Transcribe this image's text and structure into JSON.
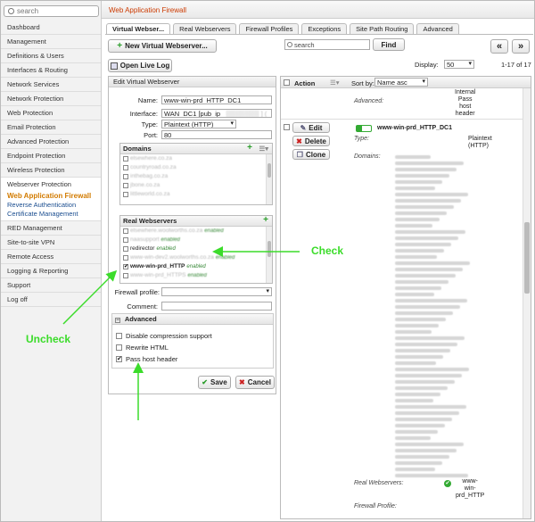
{
  "sidebar": {
    "search_placeholder": "search",
    "items": [
      "Dashboard",
      "Management",
      "Definitions & Users",
      "Interfaces & Routing",
      "Network Services",
      "Network Protection",
      "Web Protection",
      "Email Protection",
      "Advanced Protection",
      "Endpoint Protection",
      "Wireless Protection"
    ],
    "open_group": {
      "label": "Webserver Protection",
      "subs": [
        "Web Application Firewall",
        "Reverse Authentication",
        "Certificate Management"
      ]
    },
    "items_after": [
      "RED Management",
      "Site-to-site VPN",
      "Remote Access",
      "Logging & Reporting",
      "Support",
      "Log off"
    ]
  },
  "header": {
    "title": "Web Application Firewall"
  },
  "tabs": [
    "Virtual Webser...",
    "Real Webservers",
    "Firewall Profiles",
    "Exceptions",
    "Site Path Routing",
    "Advanced"
  ],
  "toolbar": {
    "new_vws": "New Virtual Webserver...",
    "open_live_log": "Open Live Log",
    "search_placeholder": "search",
    "find": "Find",
    "prev": "«",
    "next": "»",
    "display_label": "Display:",
    "display_value": "50",
    "range": "1-17 of 17"
  },
  "edit": {
    "title": "Edit Virtual Webserver",
    "name_label": "Name:",
    "name_value": "www-win-prd_HTTP_DC1",
    "interface_label": "Interface:",
    "interface_value": "WAN_DC1 [pub_ip_",
    "type_label": "Type:",
    "type_value": "Plaintext (HTTP)",
    "port_label": "Port:",
    "port_value": "80",
    "domains_head": "Domains",
    "domains": [
      "elsewhere.co.za",
      "countryroad.co.za",
      "inthebag.co.za",
      "jbone.co.za",
      "littleworld.co.za"
    ],
    "real_head": "Real Webservers",
    "real_rows": [
      {
        "name": "elsewhere.woolworths.co.za",
        "status": "enabled",
        "checked": false,
        "blur": true
      },
      {
        "name": "naasupport",
        "status": "enabled",
        "checked": false,
        "blur": true
      },
      {
        "name": "redirector",
        "status": "enabled",
        "checked": false,
        "blur": false
      },
      {
        "name": "www-win-dev2.woolworths.co.za",
        "status": "enabled",
        "checked": false,
        "blur": true
      },
      {
        "name": "www-win-prd_HTTP",
        "status": "enabled",
        "checked": true,
        "blur": false
      },
      {
        "name": "www-win-prd_HTTPS",
        "status": "enabled",
        "checked": false,
        "blur": true
      }
    ],
    "firewall_label": "Firewall profile:",
    "comment_label": "Comment:",
    "advanced_head": "Advanced",
    "opt_compression": "Disable compression support",
    "opt_rewrite": "Rewrite HTML",
    "opt_passhost": "Pass host header",
    "save": "Save",
    "cancel": "Cancel",
    "passhost_checked_mark": "✔"
  },
  "list": {
    "action": "Action",
    "sort_label": "Sort by:",
    "sort_value": "Name asc",
    "prev_advanced_label": "Advanced:",
    "prev_advanced_value": "Internal\nPass\nhost\nheader",
    "btn_edit": "Edit",
    "btn_delete": "Delete",
    "btn_clone": "Clone",
    "item_name": "www-win-prd_HTTP_DC1",
    "type_label": "Type:",
    "type_value": "Plaintext\n(HTTP)",
    "domains_label": "Domains:",
    "real_label": "Real Webservers:",
    "real_value": "www-\nwin-\nprd_HTTP",
    "fw_label": "Firewall Profile:"
  },
  "annotations": {
    "check": "Check",
    "uncheck": "Uncheck"
  },
  "colors": {
    "accent": "#cc3a00",
    "active_nav": "#d27b00",
    "arrow": "#3bdc2a",
    "link": "#1a4d8f"
  }
}
